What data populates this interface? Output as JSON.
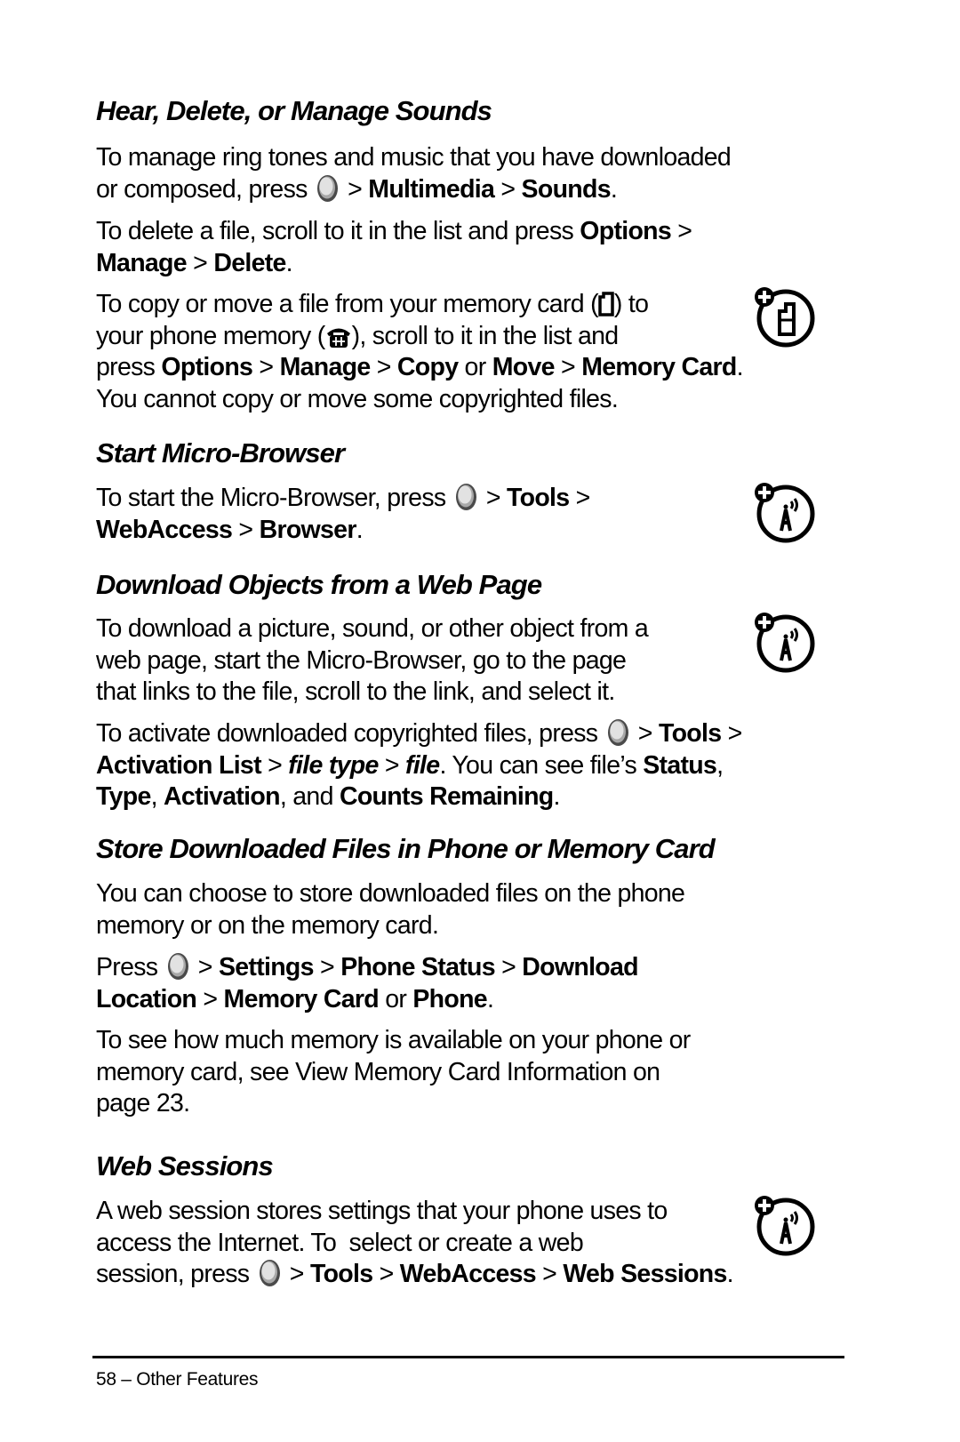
{
  "sections": [
    {
      "heading": "Hear, Delete, or Manage Sounds",
      "p1": {
        "t1": "To manage ring tones and music that you have downloaded",
        "t2": "or composed, press",
        "sep1": " > ",
        "b1": "Multimedia",
        "sep2": " > ",
        "b2": "Sounds",
        "end": "."
      },
      "p2": {
        "t1": "To delete a file, scroll to it in the list and press ",
        "b1": "Options",
        "sep1": " >",
        "b2": "Manage",
        "sep2": " > ",
        "b3": "Delete",
        "end": "."
      },
      "p3": {
        "t1": "To copy or move a file from your memory card (",
        "t2": ") to",
        "t3": "your phone memory (",
        "t4": "), scroll to it in the list and",
        "t5": "press ",
        "b1": "Options",
        "sep1": " > ",
        "b2": "Manage",
        "sep2": " > ",
        "b3": "Copy",
        "or": " or ",
        "b4": "Move",
        "sep3": " > ",
        "b5": "Memory Card",
        "end": ".",
        "t6": "You cannot copy or move some copyrighted files."
      }
    },
    {
      "heading": "Start Micro-Browser",
      "p1": {
        "t1": "To start the Micro-Browser, press",
        "sep1": " > ",
        "b1": "Tools",
        "sep2": " >",
        "b2": "WebAccess",
        "sep3": " > ",
        "b3": "Browser",
        "end": "."
      }
    },
    {
      "heading": "Download Objects from a Web Page",
      "p1": {
        "l1": "To download a picture, sound, or other object from a",
        "l2": "web page, start the Micro-Browser, go to the page",
        "l3": "that links to the file, scroll to the link, and select it."
      },
      "p2": {
        "t1": "To activate downloaded copyrighted files, press",
        "sep1": " > ",
        "b1": "Tools",
        "sep2": " >",
        "b2": "Activation List",
        "sep3": " > ",
        "i1": "file type",
        "sep4": " > ",
        "i2": "file",
        "t2": ". You can see file’s ",
        "b3": "Status",
        "c1": ",",
        "b4": "Type",
        "c2": ", ",
        "b5": "Activation",
        "t3": ", and ",
        "b6": "Counts Remaining",
        "end": "."
      }
    },
    {
      "heading": "Store Downloaded Files in Phone or Memory Card",
      "p1": {
        "l1": "You can choose to store downloaded files on the phone",
        "l2": "memory or on the memory card."
      },
      "p2": {
        "t1": "Press",
        "sep1": " > ",
        "b1": "Settings",
        "sep2": " > ",
        "b2": "Phone Status",
        "sep3": " > ",
        "b3": "Download",
        "b4": "Location",
        "sep4": " > ",
        "b5": "Memory Card",
        "or": " or ",
        "b6": "Phone",
        "end": "."
      },
      "p3": {
        "l1": "To see how much memory is available on your phone or",
        "l2": "memory card, see View Memory Card Information on",
        "l3": "page 23."
      }
    },
    {
      "heading": "Web Sessions",
      "p1": {
        "l1": "A web session stores settings that your phone uses to",
        "l2": "access the Internet. To  select or create a web",
        "t1": "session, press",
        "sep1": " > ",
        "b1": "Tools",
        "sep2": " > ",
        "b2": "WebAccess",
        "sep3": " > ",
        "b3": "Web Sessions",
        "end": "."
      }
    }
  ],
  "icons": {
    "menu_key": "menu-key-icon",
    "memory_card": "memory-card-icon",
    "phone_memory": "phone-memory-icon",
    "optional_feature_card": "optional-feature-memory-card-icon",
    "optional_feature_network": "optional-feature-network-icon"
  },
  "footer": {
    "text": "58 – Other Features"
  }
}
